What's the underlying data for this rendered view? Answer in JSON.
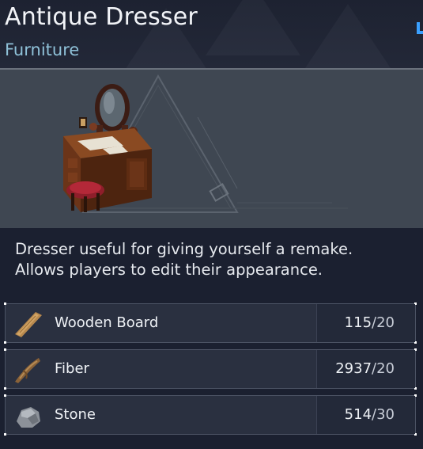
{
  "item": {
    "title": "Antique Dresser",
    "category": "Furniture",
    "description_lines": [
      "Dresser useful for giving yourself a remake.",
      "Allows players to edit their appearance."
    ]
  },
  "materials": [
    {
      "name": "Wooden Board",
      "have": "115",
      "need": "/20",
      "icon": "wooden-board-icon"
    },
    {
      "name": "Fiber",
      "have": "2937",
      "need": "/20",
      "icon": "fiber-icon"
    },
    {
      "name": "Stone",
      "have": "514",
      "need": "/30",
      "icon": "stone-icon"
    }
  ],
  "colors": {
    "background": "#1b2030",
    "subtitle": "#8fc1d8",
    "accent": "#3aa0ff",
    "image_panel": "#3f4752"
  }
}
